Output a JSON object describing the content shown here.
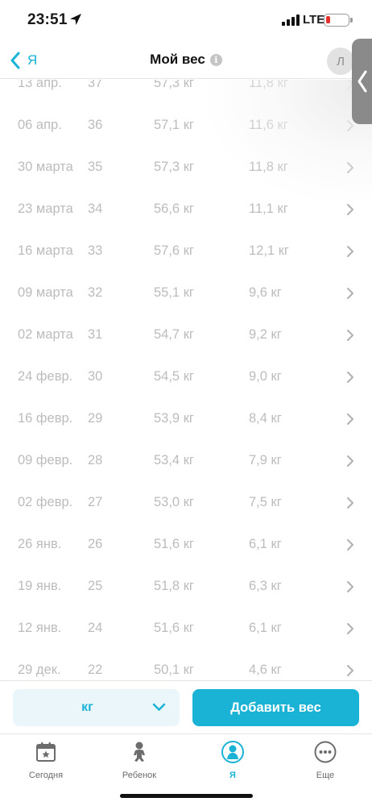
{
  "status_bar": {
    "time": "23:51",
    "network": "LTE",
    "battery_color": "#e5322d"
  },
  "nav": {
    "back_label": "Я",
    "title": "Мой вес",
    "info_glyph": "i",
    "avatar_initial": "Л"
  },
  "weight_log": {
    "rows": [
      {
        "date": "13 апр.",
        "week": "37",
        "weight": "57,3 кг",
        "gain": "11,8 кг"
      },
      {
        "date": "06 апр.",
        "week": "36",
        "weight": "57,1 кг",
        "gain": "11,6 кг"
      },
      {
        "date": "30 марта",
        "week": "35",
        "weight": "57,3 кг",
        "gain": "11,8 кг"
      },
      {
        "date": "23 марта",
        "week": "34",
        "weight": "56,6 кг",
        "gain": "11,1 кг"
      },
      {
        "date": "16 марта",
        "week": "33",
        "weight": "57,6 кг",
        "gain": "12,1 кг"
      },
      {
        "date": "09 марта",
        "week": "32",
        "weight": "55,1 кг",
        "gain": "9,6 кг"
      },
      {
        "date": "02 марта",
        "week": "31",
        "weight": "54,7 кг",
        "gain": "9,2 кг"
      },
      {
        "date": "24 февр.",
        "week": "30",
        "weight": "54,5 кг",
        "gain": "9,0 кг"
      },
      {
        "date": "16 февр.",
        "week": "29",
        "weight": "53,9 кг",
        "gain": "8,4 кг"
      },
      {
        "date": "09 февр.",
        "week": "28",
        "weight": "53,4 кг",
        "gain": "7,9 кг"
      },
      {
        "date": "02 февр.",
        "week": "27",
        "weight": "53,0 кг",
        "gain": "7,5 кг"
      },
      {
        "date": "26 янв.",
        "week": "26",
        "weight": "51,6 кг",
        "gain": "6,1 кг"
      },
      {
        "date": "19 янв.",
        "week": "25",
        "weight": "51,8 кг",
        "gain": "6,3 кг"
      },
      {
        "date": "12 янв.",
        "week": "24",
        "weight": "51,6 кг",
        "gain": "6,1 кг"
      },
      {
        "date": "29 дек.",
        "week": "22",
        "weight": "50,1 кг",
        "gain": "4,6 кг"
      }
    ]
  },
  "action_bar": {
    "unit_value": "кг",
    "add_label": "Добавить вес"
  },
  "tabs": [
    {
      "label": "Сегодня",
      "icon": "calendar-star-icon"
    },
    {
      "label": "Ребенок",
      "icon": "baby-icon"
    },
    {
      "label": "Я",
      "icon": "mother-icon"
    },
    {
      "label": "Еще",
      "icon": "more-icon"
    }
  ],
  "colors": {
    "accent": "#1ab3d6",
    "row_text": "#bcbcbc",
    "tab_inactive": "#6c6c6c"
  }
}
